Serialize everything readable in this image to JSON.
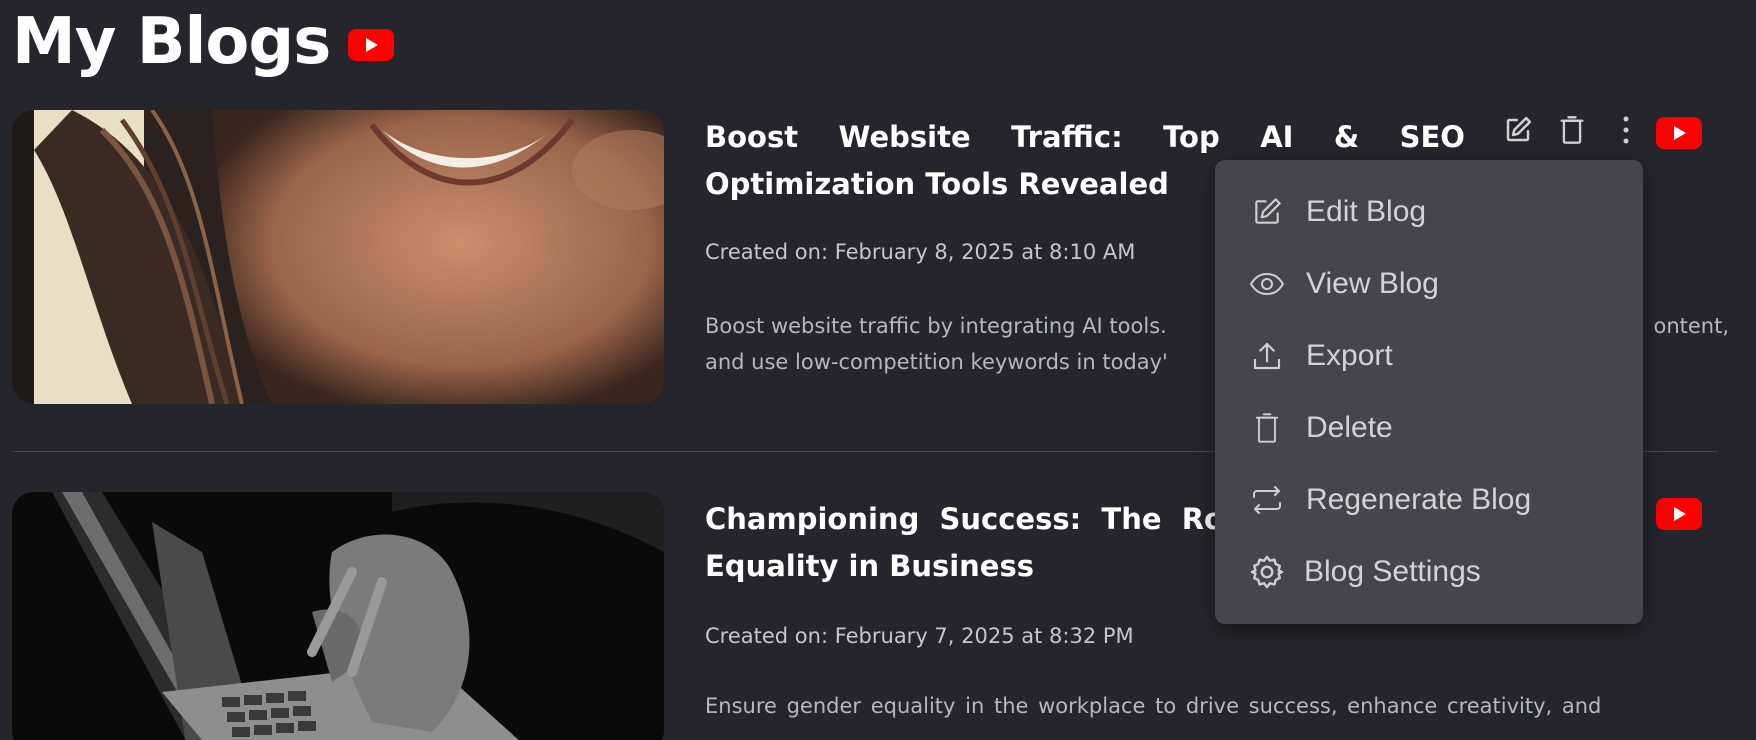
{
  "page": {
    "title": "My Blogs"
  },
  "colors": {
    "background": "#25262d",
    "youtube_red": "#ff0000",
    "menu_bg": "#45464d"
  },
  "blogs": [
    {
      "title_line1_words": [
        "Boost",
        "Website",
        "Traffic:",
        "Top",
        "AI",
        "&",
        "SEO"
      ],
      "title_line2": "Optimization Tools Revealed",
      "created": "Created on: February 8, 2025 at 8:10 AM",
      "excerpt_line1_left": "Boost website traffic by integrating AI tools.",
      "excerpt_line1_right": "ontent,",
      "excerpt_line2": "and use low-competition keywords in today'",
      "thumbnail_icon": "smiling-woman-photo"
    },
    {
      "title_line1": "Championing  Success:  The  Ro",
      "title_line2": "Equality in Business",
      "created": "Created on: February 7, 2025 at 8:32 PM",
      "excerpt_line1": "Ensure gender equality in the workplace to drive success, enhance creativity, and",
      "thumbnail_icon": "laptop-typing-photo"
    }
  ],
  "actions": {
    "icons": [
      "edit-icon",
      "trash-icon",
      "more-vertical-icon",
      "youtube-icon"
    ]
  },
  "menu": {
    "items": [
      {
        "label": "Edit Blog",
        "icon": "edit-icon"
      },
      {
        "label": "View Blog",
        "icon": "eye-icon"
      },
      {
        "label": "Export",
        "icon": "upload-icon"
      },
      {
        "label": "Delete",
        "icon": "trash-icon"
      },
      {
        "label": "Regenerate Blog",
        "icon": "regenerate-icon"
      },
      {
        "label": "Blog Settings",
        "icon": "gear-icon"
      }
    ]
  }
}
